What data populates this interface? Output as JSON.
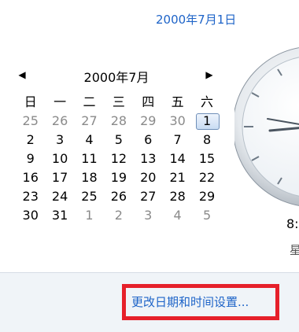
{
  "header": {
    "date_link": "2000年7月1日"
  },
  "calendar": {
    "month_title": "2000年7月",
    "prev_arrow": "◀",
    "next_arrow": "▶",
    "weekdays": [
      "日",
      "一",
      "二",
      "三",
      "四",
      "五",
      "六"
    ],
    "weeks": [
      [
        {
          "d": "25",
          "out": true
        },
        {
          "d": "26",
          "out": true
        },
        {
          "d": "27",
          "out": true
        },
        {
          "d": "28",
          "out": true
        },
        {
          "d": "29",
          "out": true
        },
        {
          "d": "30",
          "out": true
        },
        {
          "d": "1",
          "out": false,
          "selected": true
        }
      ],
      [
        {
          "d": "2"
        },
        {
          "d": "3"
        },
        {
          "d": "4"
        },
        {
          "d": "5"
        },
        {
          "d": "6"
        },
        {
          "d": "7"
        },
        {
          "d": "8"
        }
      ],
      [
        {
          "d": "9"
        },
        {
          "d": "10"
        },
        {
          "d": "11"
        },
        {
          "d": "12"
        },
        {
          "d": "13"
        },
        {
          "d": "14"
        },
        {
          "d": "15"
        }
      ],
      [
        {
          "d": "16"
        },
        {
          "d": "17"
        },
        {
          "d": "18"
        },
        {
          "d": "19"
        },
        {
          "d": "20"
        },
        {
          "d": "21"
        },
        {
          "d": "22"
        }
      ],
      [
        {
          "d": "23"
        },
        {
          "d": "24"
        },
        {
          "d": "25"
        },
        {
          "d": "26"
        },
        {
          "d": "27"
        },
        {
          "d": "28"
        },
        {
          "d": "29"
        }
      ],
      [
        {
          "d": "30"
        },
        {
          "d": "31"
        },
        {
          "d": "1",
          "out": true
        },
        {
          "d": "2",
          "out": true
        },
        {
          "d": "3",
          "out": true
        },
        {
          "d": "4",
          "out": true
        },
        {
          "d": "5",
          "out": true
        }
      ]
    ]
  },
  "clock": {
    "time_text": "8:",
    "weekday_text": "星"
  },
  "footer": {
    "settings_link": "更改日期和时间设置..."
  },
  "colors": {
    "link": "#1e64c8",
    "highlight": "#e6202a",
    "footer_bg": "#f0f4f8"
  }
}
